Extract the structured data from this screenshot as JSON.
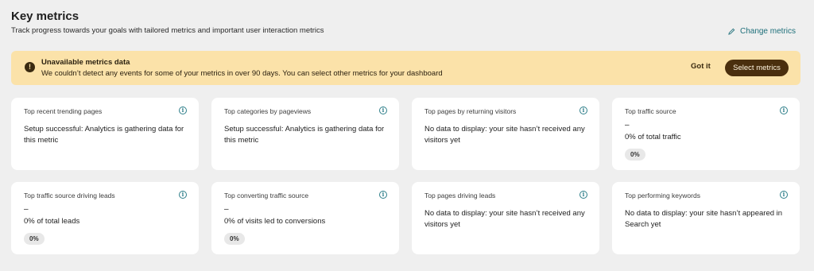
{
  "header": {
    "title": "Key metrics",
    "subtitle": "Track progress towards your goals with tailored metrics and important user interaction metrics",
    "change_metrics_label": "Change metrics"
  },
  "banner": {
    "title": "Unavailable metrics data",
    "description": "We couldn’t detect any events for some of your metrics in over 90 days. You can select other metrics for your dashboard",
    "got_it_label": "Got it",
    "select_metrics_label": "Select metrics",
    "warning_glyph": "!"
  },
  "cards": [
    {
      "title": "Top recent trending pages",
      "message": "Setup successful: Analytics is gathering data for this metric"
    },
    {
      "title": "Top categories by pageviews",
      "message": "Setup successful: Analytics is gathering data for this metric"
    },
    {
      "title": "Top pages by returning visitors",
      "message": "No data to display: your site hasn’t received any visitors yet"
    },
    {
      "title": "Top traffic source",
      "dash": "–",
      "value": "0% of total traffic",
      "badge": "0%"
    },
    {
      "title": "Top traffic source driving leads",
      "dash": "–",
      "value": "0% of total leads",
      "badge": "0%"
    },
    {
      "title": "Top converting traffic source",
      "dash": "–",
      "value": "0% of visits led to conversions",
      "badge": "0%"
    },
    {
      "title": "Top pages driving leads",
      "message": "No data to display: your site hasn’t received any visitors yet"
    },
    {
      "title": "Top performing keywords",
      "message": "No data to display: your site hasn’t appeared in Search yet"
    }
  ],
  "info_glyph": "i",
  "colors": {
    "accent": "#1e6f7a",
    "banner_bg": "#fbe2a9",
    "primary_button": "#4a2f0e",
    "page_bg": "#efefef"
  }
}
